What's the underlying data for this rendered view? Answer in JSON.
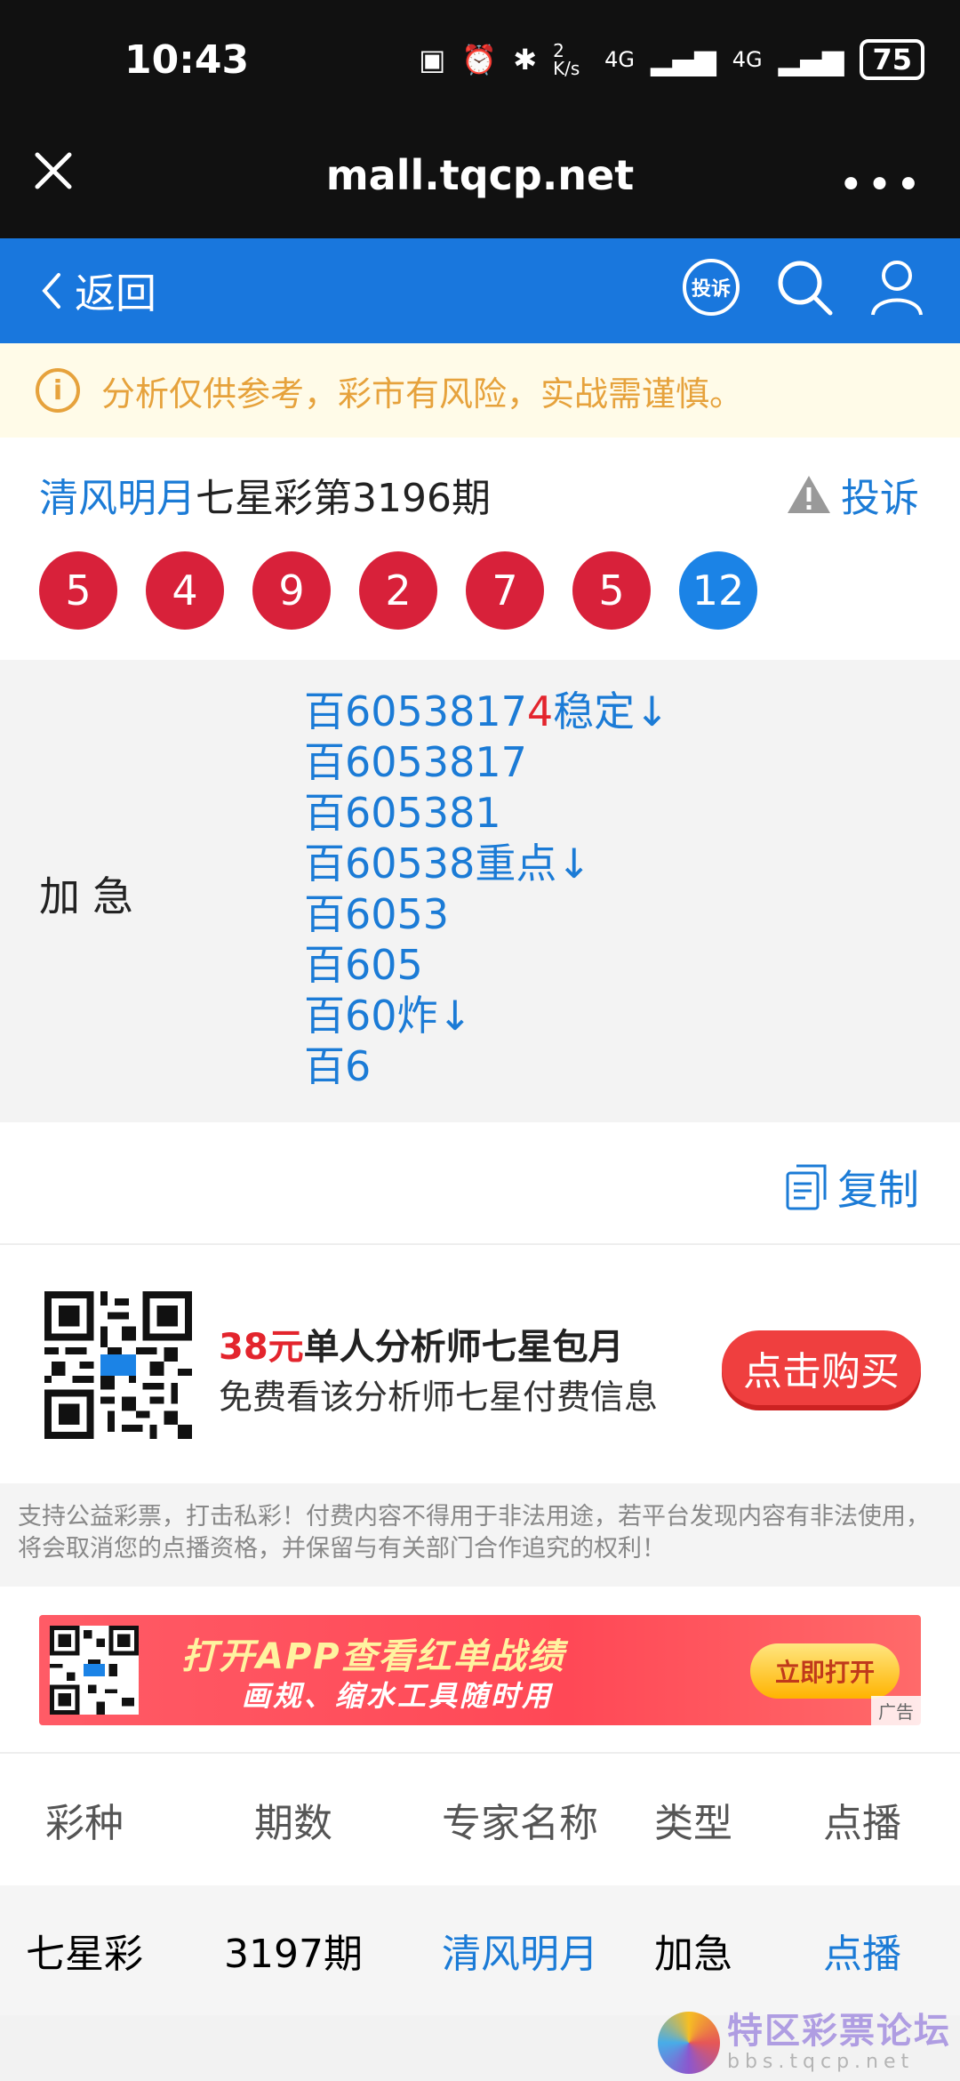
{
  "status_bar": {
    "time": "10:43",
    "net_speed": "2 K/s",
    "signal1": "4G",
    "signal2": "4G",
    "battery": "75"
  },
  "browser": {
    "url": "mall.tqcp.net"
  },
  "header": {
    "back_label": "返回",
    "complain_icon_text": "投诉"
  },
  "notice": {
    "text": "分析仅供参考，彩市有风险，实战需谨慎。"
  },
  "plan": {
    "author": "清风明月",
    "title_rest": "七星彩第3196期",
    "complain_label": "投诉",
    "balls": [
      "5",
      "4",
      "9",
      "2",
      "7",
      "5"
    ],
    "special_ball": "12"
  },
  "content": {
    "label": "加急",
    "line1_a": "百6053817",
    "line1_red": "4",
    "line1_b": "稳定↓",
    "lines": [
      "百6053817",
      "百605381",
      "百60538重点↓",
      "百6053",
      "百605",
      "百60炸↓",
      "百6"
    ]
  },
  "copy_label": "复制",
  "promo": {
    "price": "38元",
    "title_rest": "单人分析师七星包月",
    "subtitle": "免费看该分析师七星付费信息",
    "buy_label": "点击购买"
  },
  "disclaimer": "支持公益彩票，打击私彩！付费内容不得用于非法用途，若平台发现内容有非法使用，将会取消您的点播资格，并保留与有关部门合作追究的权利！",
  "banner": {
    "line1": "打开APP查看红单战绩",
    "line2": "画规、缩水工具随时用",
    "button": "立即打开",
    "ad_tag": "广告"
  },
  "table": {
    "headers": [
      "彩种",
      "期数",
      "专家名称",
      "类型",
      "点播"
    ],
    "rows": [
      {
        "lottery": "七星彩",
        "issue": "3197期",
        "expert": "清风明月",
        "type": "加急",
        "action": "点播"
      }
    ]
  },
  "watermark": {
    "name": "特区彩票论坛",
    "site": "bbs.tqcp.net"
  },
  "colors": {
    "primary_blue": "#1977dd",
    "ball_red": "#d8213a",
    "ball_blue": "#1b83e6",
    "notice_text": "#e6a23c",
    "buy_red": "#ef3f3f"
  }
}
